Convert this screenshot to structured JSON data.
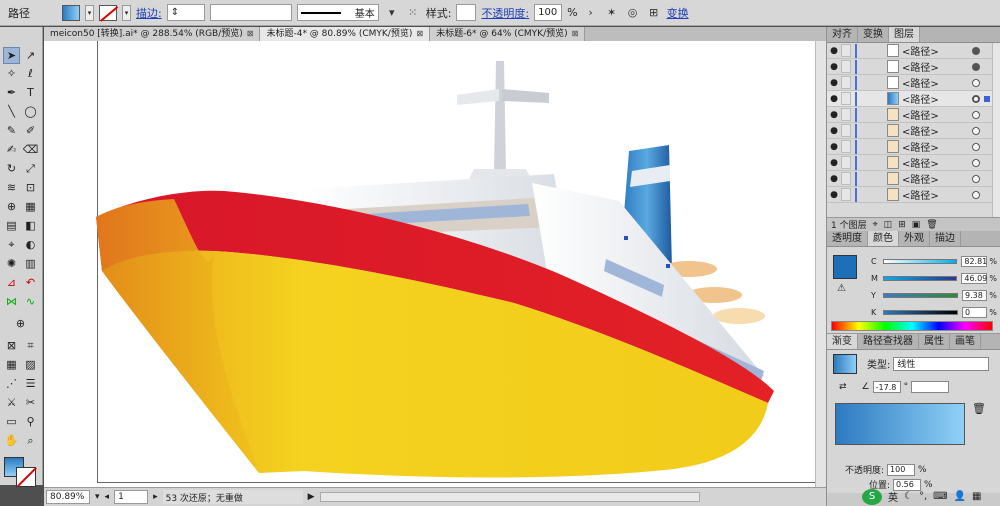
{
  "control_bar": {
    "object_type": "路径",
    "stroke_label": "描边:",
    "stroke_profile": "基本",
    "style_label": "样式:",
    "opacity_label": "不透明度:",
    "opacity_value": "100",
    "opacity_unit": "%",
    "transform_label": "变换"
  },
  "tabs": [
    {
      "label": "meicon50 [转换].ai* @ 288.54% (RGB/预览)",
      "close": "⊠"
    },
    {
      "label": "未标题-4* @ 80.89% (CMYK/预览)",
      "close": "⊠"
    },
    {
      "label": "未标题-6* @ 64% (CMYK/预览)",
      "close": "⊠"
    }
  ],
  "status_bar": {
    "zoom": "80.89%",
    "artboard": "1",
    "history": "53 次还原；无重做"
  },
  "layers_panel": {
    "tabs": [
      "对齐",
      "变换",
      "图层"
    ],
    "rows": [
      {
        "name": "<路径>",
        "target": "filled"
      },
      {
        "name": "<路径>",
        "target": "filled"
      },
      {
        "name": "<路径>",
        "target": "empty"
      },
      {
        "name": "<路径>",
        "target": "selected"
      },
      {
        "name": "<路径>",
        "target": "empty"
      },
      {
        "name": "<路径>",
        "target": "empty"
      },
      {
        "name": "<路径>",
        "target": "empty"
      },
      {
        "name": "<路径>",
        "target": "empty"
      },
      {
        "name": "<路径>",
        "target": "empty"
      },
      {
        "name": "<路径>",
        "target": "empty"
      }
    ],
    "footer": "1 个图层"
  },
  "color_panel": {
    "tabs": [
      "透明度",
      "颜色",
      "外观",
      "描边"
    ],
    "channels": [
      {
        "label": "C",
        "value": "82.81",
        "unit": "%"
      },
      {
        "label": "M",
        "value": "46.09",
        "unit": "%"
      },
      {
        "label": "Y",
        "value": "9.38",
        "unit": "%"
      },
      {
        "label": "K",
        "value": "0",
        "unit": "%"
      }
    ]
  },
  "gradient_panel": {
    "tabs": [
      "渐变",
      "路径查找器",
      "属性",
      "画笔"
    ],
    "type_label": "类型:",
    "type_value": "线性",
    "angle": "-17.8",
    "opacity_label": "不透明度:",
    "opacity_value": "100",
    "location_label": "位置:",
    "location_value": "0.56",
    "unit": "%"
  },
  "taskbar": {
    "ime": "英"
  },
  "colors": {
    "hull_yellow": "#f2cc1a",
    "hull_red": "#df1f26",
    "accent_blue": "#2d7ac1",
    "light_blue": "#8fd0f6",
    "ui_gray": "#d4d4d4"
  }
}
